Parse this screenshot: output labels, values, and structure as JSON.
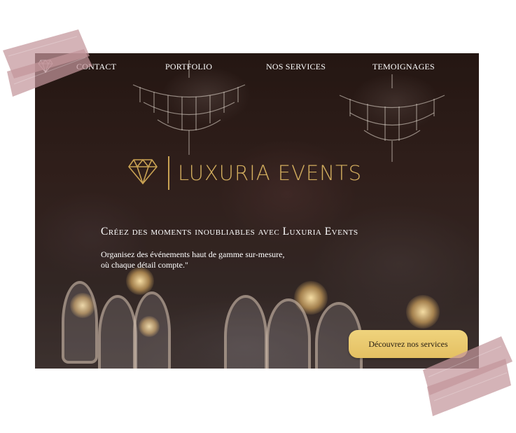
{
  "nav": {
    "items": [
      {
        "label": "CONTACT"
      },
      {
        "label": "PORTFOLIO"
      },
      {
        "label": "NOS SERVICES"
      },
      {
        "label": "TEMOIGNAGES"
      }
    ],
    "logo_icon": "diamond-icon"
  },
  "brand": {
    "name": "LUXURIA EVENTS",
    "logo_icon": "diamond-icon"
  },
  "hero": {
    "headline": "Créez des moments inoubliables avec Luxuria Events",
    "subtext_line1": "Organisez des événements haut de gamme sur-mesure,",
    "subtext_line2": "où chaque détail compte.\""
  },
  "cta": {
    "label": "Découvrez nos services"
  },
  "colors": {
    "gold": "#d2ad5e",
    "button": "#e9c96c",
    "tape": "#c9a0a4"
  }
}
